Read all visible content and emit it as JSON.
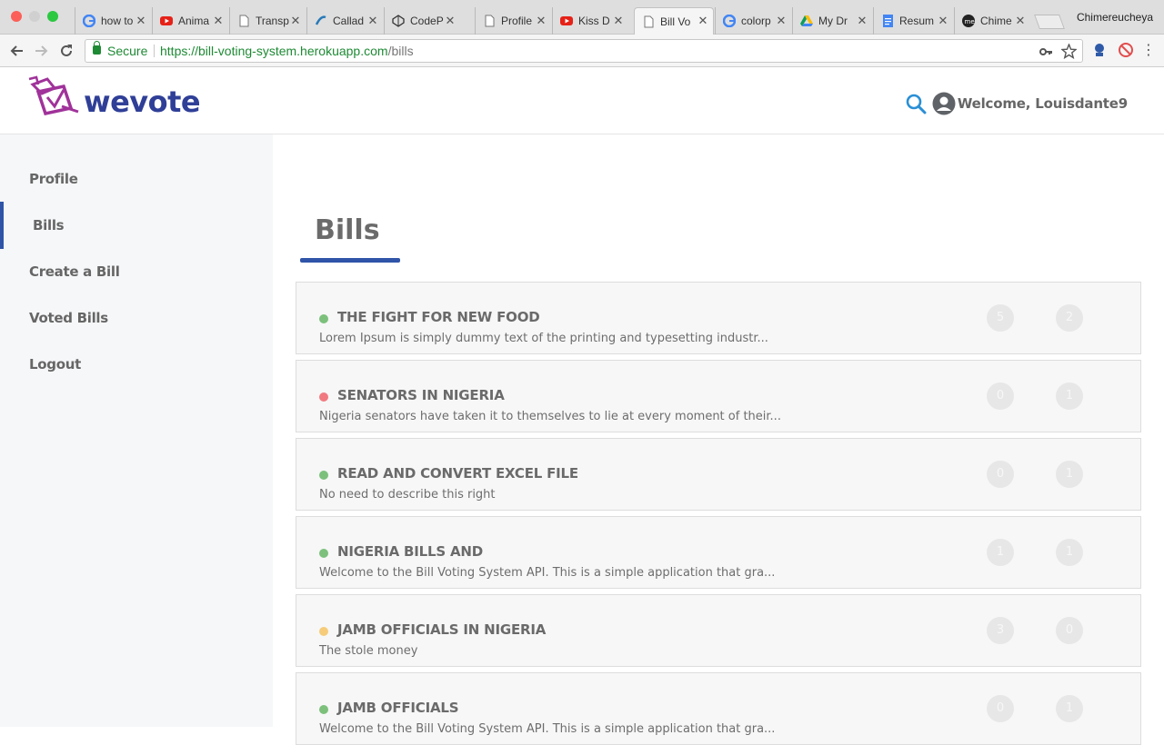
{
  "browser": {
    "tabs": [
      {
        "title": "how to",
        "icon": "google-icon"
      },
      {
        "title": "Anima",
        "icon": "youtube-icon"
      },
      {
        "title": "Transp",
        "icon": "page-icon"
      },
      {
        "title": "Callad",
        "icon": "page-icon"
      },
      {
        "title": "CodeP",
        "icon": "codepen-icon"
      },
      {
        "title": "Profile",
        "icon": "page-icon"
      },
      {
        "title": "Kiss D",
        "icon": "youtube-icon"
      },
      {
        "title": "Bill Vo",
        "icon": "page-icon",
        "active": true
      },
      {
        "title": "colorp",
        "icon": "google-icon"
      },
      {
        "title": "My Dr",
        "icon": "drive-icon"
      },
      {
        "title": "Resum",
        "icon": "docs-icon"
      },
      {
        "title": "Chime",
        "icon": "medium-icon"
      }
    ],
    "profile_name": "Chimereucheya",
    "secure_label": "Secure",
    "url_host": "https://bill-voting-system.herokuapp.com",
    "url_path": "/bills"
  },
  "header": {
    "logo_text": "wevote",
    "welcome": "Welcome, Louisdante9"
  },
  "sidebar": {
    "items": [
      {
        "label": "Profile"
      },
      {
        "label": "Bills",
        "active": true
      },
      {
        "label": "Create a Bill"
      },
      {
        "label": "Voted Bills"
      },
      {
        "label": "Logout"
      }
    ]
  },
  "main": {
    "title": "Bills",
    "bills": [
      {
        "title": "THE FIGHT FOR NEW FOOD",
        "description": "Lorem Ipsum is simply dummy text of the printing and typesetting industr...",
        "status_color": "#7cc07c",
        "upvotes": "5",
        "downvotes": "2"
      },
      {
        "title": "SENATORS IN NIGERIA",
        "description": "Nigeria senators have taken it to themselves to lie at every moment of their...",
        "status_color": "#f07a80",
        "upvotes": "0",
        "downvotes": "1"
      },
      {
        "title": "READ AND CONVERT EXCEL FILE",
        "description": "No need to describe this right",
        "status_color": "#7cc07c",
        "upvotes": "0",
        "downvotes": "1"
      },
      {
        "title": "NIGERIA BILLS AND",
        "description": "Welcome to the Bill Voting System API. This is a simple application that gra...",
        "status_color": "#7cc07c",
        "upvotes": "1",
        "downvotes": "1"
      },
      {
        "title": "JAMB OFFICIALS IN NIGERIA",
        "description": "The stole money",
        "status_color": "#f6cc7a",
        "upvotes": "3",
        "downvotes": "0"
      },
      {
        "title": "JAMB OFFICIALS",
        "description": "Welcome to the Bill Voting System API. This is a simple application that gra...",
        "status_color": "#7cc07c",
        "upvotes": "0",
        "downvotes": "1"
      }
    ]
  },
  "colors": {
    "brand_blue": "#2f3f97",
    "brand_purple": "#a0329a",
    "accent": "#2f54a8",
    "search_blue": "#2a8fd6"
  }
}
